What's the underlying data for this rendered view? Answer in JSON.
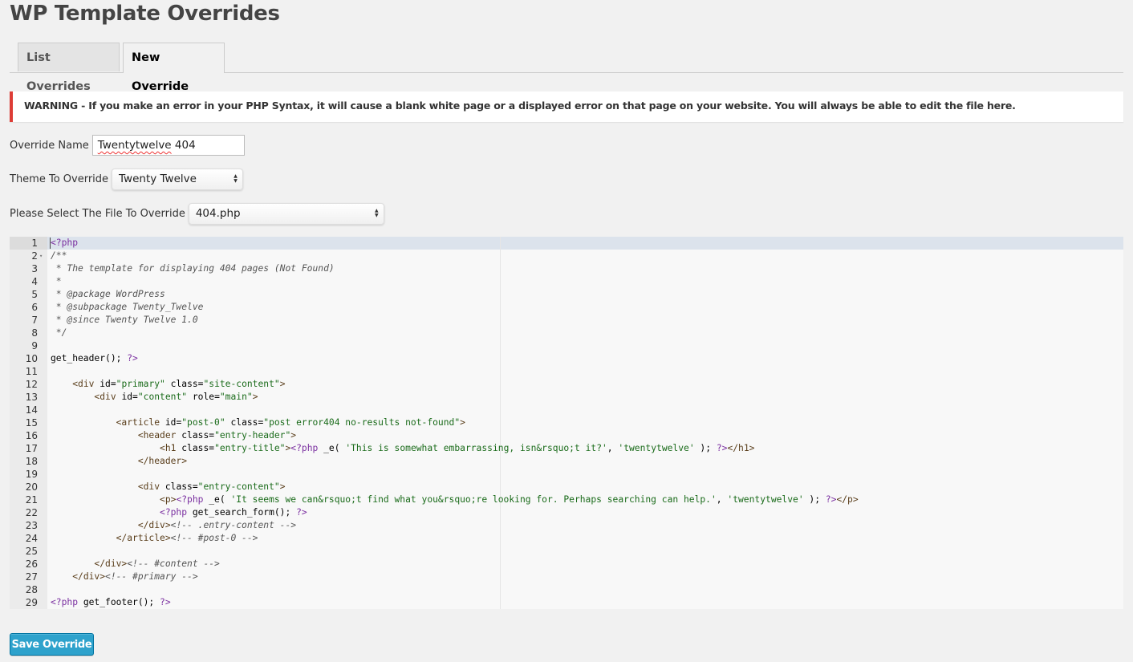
{
  "page": {
    "title": "WP Template Overrides"
  },
  "tabs": [
    {
      "label": "List Overrides",
      "active": false
    },
    {
      "label": "New Override",
      "active": true
    }
  ],
  "notice": {
    "text": "WARNING - If you make an error in your PHP Syntax, it will cause a blank white page or a displayed error on that page on your website. You will always be able to edit the file here.",
    "color": "#dd3d36"
  },
  "form": {
    "override_name": {
      "label": "Override Name",
      "value": "Twentytwelve 404"
    },
    "theme": {
      "label": "Theme To Override",
      "selected": "Twenty Twelve"
    },
    "file": {
      "label": "Please Select The File To Override",
      "selected": "404.php"
    }
  },
  "editor": {
    "active_line": 1,
    "folded_line": 2,
    "lines": [
      [
        [
          "kw",
          "<?php"
        ]
      ],
      [
        [
          "com",
          "/**"
        ]
      ],
      [
        [
          "com",
          " * The template for displaying 404 pages (Not Found)"
        ]
      ],
      [
        [
          "com",
          " *"
        ]
      ],
      [
        [
          "com",
          " * @package WordPress"
        ]
      ],
      [
        [
          "com",
          " * @subpackage Twenty_Twelve"
        ]
      ],
      [
        [
          "com",
          " * @since Twenty Twelve 1.0"
        ]
      ],
      [
        [
          "com",
          " */"
        ]
      ],
      [],
      [
        [
          "plain",
          "get_header(); "
        ],
        [
          "kw",
          "?>"
        ]
      ],
      [],
      [
        [
          "plain",
          "    "
        ],
        [
          "tag",
          "<div "
        ],
        [
          "plain",
          "id="
        ],
        [
          "str",
          "\"primary\""
        ],
        [
          "plain",
          " class="
        ],
        [
          "str",
          "\"site-content\""
        ],
        [
          "tag",
          ">"
        ]
      ],
      [
        [
          "plain",
          "        "
        ],
        [
          "tag",
          "<div "
        ],
        [
          "plain",
          "id="
        ],
        [
          "str",
          "\"content\""
        ],
        [
          "plain",
          " role="
        ],
        [
          "str",
          "\"main\""
        ],
        [
          "tag",
          ">"
        ]
      ],
      [],
      [
        [
          "plain",
          "            "
        ],
        [
          "tag",
          "<article "
        ],
        [
          "plain",
          "id="
        ],
        [
          "str",
          "\"post-0\""
        ],
        [
          "plain",
          " class="
        ],
        [
          "str",
          "\"post error404 no-results not-found\""
        ],
        [
          "tag",
          ">"
        ]
      ],
      [
        [
          "plain",
          "                "
        ],
        [
          "tag",
          "<header "
        ],
        [
          "plain",
          "class="
        ],
        [
          "str",
          "\"entry-header\""
        ],
        [
          "tag",
          ">"
        ]
      ],
      [
        [
          "plain",
          "                    "
        ],
        [
          "tag",
          "<h1 "
        ],
        [
          "plain",
          "class="
        ],
        [
          "str",
          "\"entry-title\""
        ],
        [
          "tag",
          ">"
        ],
        [
          "kw",
          "<?php"
        ],
        [
          "plain",
          " _e( "
        ],
        [
          "str",
          "'This is somewhat embarrassing, isn&rsquo;t it?'"
        ],
        [
          "plain",
          ", "
        ],
        [
          "str",
          "'twentytwelve'"
        ],
        [
          "plain",
          " ); "
        ],
        [
          "kw",
          "?>"
        ],
        [
          "tag",
          "</h1>"
        ]
      ],
      [
        [
          "plain",
          "                "
        ],
        [
          "tag",
          "</header>"
        ]
      ],
      [],
      [
        [
          "plain",
          "                "
        ],
        [
          "tag",
          "<div "
        ],
        [
          "plain",
          "class="
        ],
        [
          "str",
          "\"entry-content\""
        ],
        [
          "tag",
          ">"
        ]
      ],
      [
        [
          "plain",
          "                    "
        ],
        [
          "tag",
          "<p>"
        ],
        [
          "kw",
          "<?php"
        ],
        [
          "plain",
          " _e( "
        ],
        [
          "str",
          "'It seems we can&rsquo;t find what you&rsquo;re looking for. Perhaps searching can help.'"
        ],
        [
          "plain",
          ", "
        ],
        [
          "str",
          "'twentytwelve'"
        ],
        [
          "plain",
          " ); "
        ],
        [
          "kw",
          "?>"
        ],
        [
          "tag",
          "</p>"
        ]
      ],
      [
        [
          "plain",
          "                    "
        ],
        [
          "kw",
          "<?php"
        ],
        [
          "plain",
          " get_search_form(); "
        ],
        [
          "kw",
          "?>"
        ]
      ],
      [
        [
          "plain",
          "                "
        ],
        [
          "tag",
          "</div>"
        ],
        [
          "com",
          "<!-- .entry-content -->"
        ]
      ],
      [
        [
          "plain",
          "            "
        ],
        [
          "tag",
          "</article>"
        ],
        [
          "com",
          "<!-- #post-0 -->"
        ]
      ],
      [],
      [
        [
          "plain",
          "        "
        ],
        [
          "tag",
          "</div>"
        ],
        [
          "com",
          "<!-- #content -->"
        ]
      ],
      [
        [
          "plain",
          "    "
        ],
        [
          "tag",
          "</div>"
        ],
        [
          "com",
          "<!-- #primary -->"
        ]
      ],
      [],
      [
        [
          "kw",
          "<?php"
        ],
        [
          "plain",
          " get_footer(); "
        ],
        [
          "kw",
          "?>"
        ]
      ]
    ]
  },
  "actions": {
    "save_label": "Save Override",
    "save_color": "#2ea2cc"
  }
}
